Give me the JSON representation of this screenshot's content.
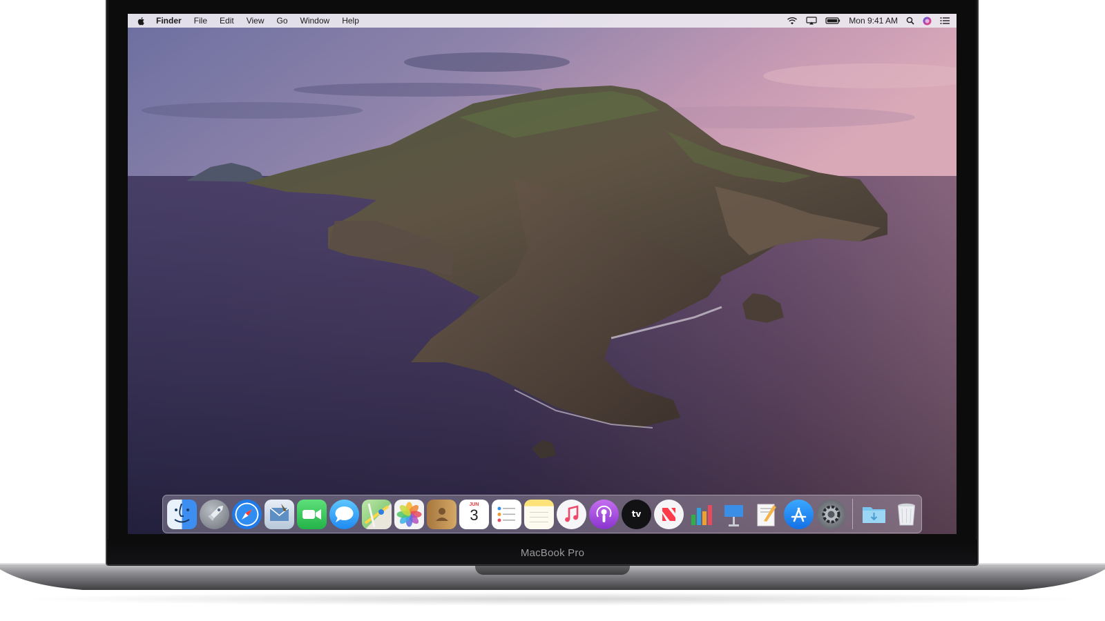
{
  "device": {
    "model_label": "MacBook Pro"
  },
  "menubar": {
    "apple_icon": "apple-logo-icon",
    "app_name": "Finder",
    "menus": [
      "File",
      "Edit",
      "View",
      "Go",
      "Window",
      "Help"
    ],
    "status_icons": [
      "wifi-icon",
      "airplay-icon",
      "battery-icon"
    ],
    "clock": "Mon 9:41 AM",
    "right_icons": [
      "spotlight-search-icon",
      "siri-icon",
      "notification-center-icon"
    ]
  },
  "dock": {
    "apps": [
      {
        "name": "finder-icon",
        "color": "#3d8ef1"
      },
      {
        "name": "launchpad-icon",
        "color": "#8a8f99"
      },
      {
        "name": "safari-icon",
        "color": "#1f7ae8"
      },
      {
        "name": "mail-icon",
        "color": "#6fa3d6"
      },
      {
        "name": "facetime-icon",
        "color": "#2fc753"
      },
      {
        "name": "messages-icon",
        "color": "#34a8f5"
      },
      {
        "name": "maps-icon",
        "color": "#8ccf7e"
      },
      {
        "name": "photos-icon",
        "color": "#f4f4f4"
      },
      {
        "name": "contacts-icon",
        "color": "#c99c5c"
      },
      {
        "name": "calendar-icon",
        "color": "#ffffff"
      },
      {
        "name": "reminders-icon",
        "color": "#ffffff"
      },
      {
        "name": "notes-icon",
        "color": "#fbe37a"
      },
      {
        "name": "music-icon",
        "color": "#f6f6f8"
      },
      {
        "name": "podcasts-icon",
        "color": "#a04bdc"
      },
      {
        "name": "apple-tv-icon",
        "color": "#121214"
      },
      {
        "name": "news-icon",
        "color": "#f5f5f7"
      },
      {
        "name": "numbers-icon",
        "color": "#f5f5f5"
      },
      {
        "name": "keynote-icon",
        "color": "#d9e7f4"
      },
      {
        "name": "pages-icon",
        "color": "#f4b24a"
      },
      {
        "name": "app-store-icon",
        "color": "#1d8ef5"
      },
      {
        "name": "system-preferences-icon",
        "color": "#7d7f85"
      }
    ],
    "calendar": {
      "month": "JUN",
      "day": "3"
    },
    "tv_label": "tv",
    "right": [
      {
        "name": "downloads-folder-icon",
        "color": "#7bc6ee"
      },
      {
        "name": "trash-icon",
        "color": "#e4e6ea"
      }
    ]
  }
}
